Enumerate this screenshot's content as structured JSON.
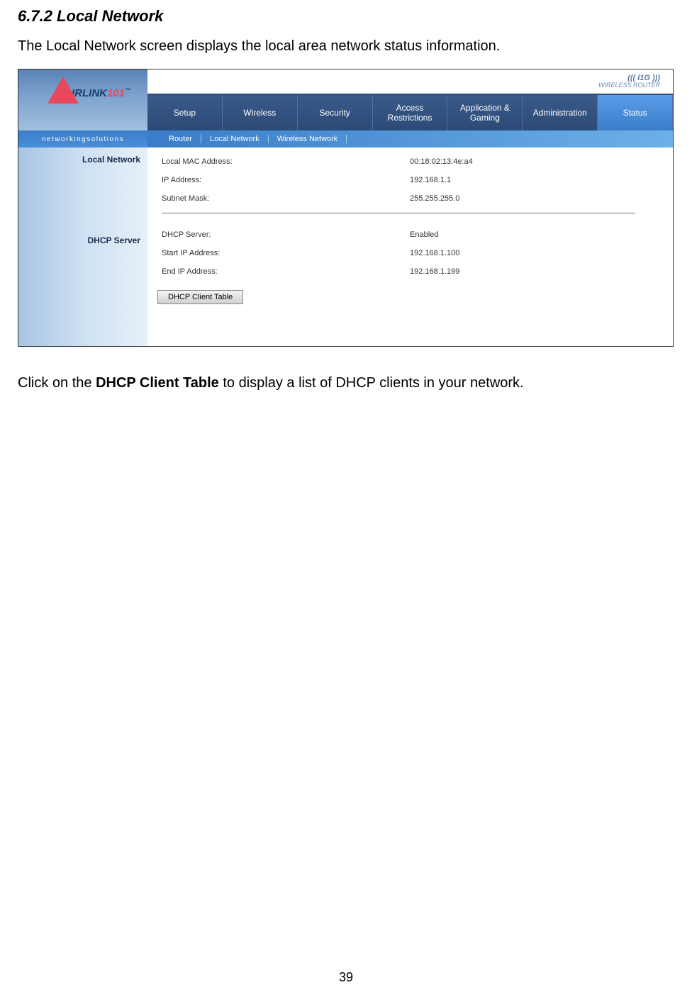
{
  "section_title": "6.7.2 Local Network",
  "intro_text": "The Local Network screen displays the local area network status information.",
  "logo": {
    "text": "IRLINK",
    "suffix": "101",
    "tm": "™"
  },
  "tagline": "networkingsolutions",
  "wifi_text_top": "I1G",
  "wifi_text_bottom": "WIRELESS ROUTER",
  "tabs": {
    "setup": "Setup",
    "wireless": "Wireless",
    "security": "Security",
    "access": "Access Restrictions",
    "app_gaming": "Application & Gaming",
    "admin": "Administration",
    "status": "Status"
  },
  "subtabs": {
    "router": "Router",
    "local_network": "Local Network",
    "wireless_network": "Wireless Network"
  },
  "sidebar": {
    "local_network": "Local Network",
    "dhcp_server": "DHCP Server"
  },
  "local_network": {
    "mac_label": "Local MAC Address:",
    "mac_value": "00:18:02:13:4e:a4",
    "ip_label": "IP Address:",
    "ip_value": "192.168.1.1",
    "subnet_label": "Subnet Mask:",
    "subnet_value": "255.255.255.0"
  },
  "dhcp": {
    "server_label": "DHCP Server:",
    "server_value": "Enabled",
    "start_label": "Start IP Address:",
    "start_value": "192.168.1.100",
    "end_label": "End IP Address:",
    "end_value": "192.168.1.199",
    "button": "DHCP Client Table"
  },
  "outro_pre": "Click on the ",
  "outro_bold": "DHCP Client Table",
  "outro_post": " to display a list of DHCP clients in your network.",
  "page_number": "39"
}
